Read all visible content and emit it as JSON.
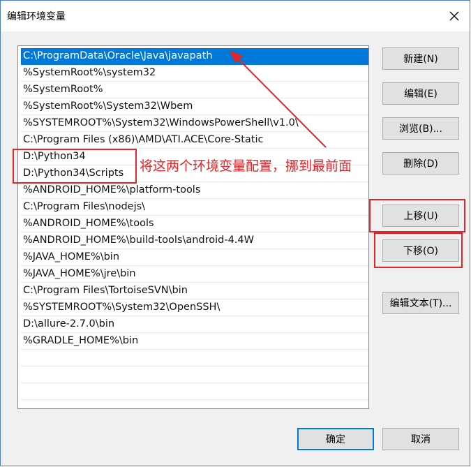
{
  "window": {
    "title": "编辑环境变量"
  },
  "list": {
    "selected_index": 0,
    "items": [
      "C:\\ProgramData\\Oracle\\Java\\javapath",
      "%SystemRoot%\\system32",
      "%SystemRoot%",
      "%SystemRoot%\\System32\\Wbem",
      "%SYSTEMROOT%\\System32\\WindowsPowerShell\\v1.0\\",
      "C:\\Program Files (x86)\\AMD\\ATI.ACE\\Core-Static",
      "D:\\Python34",
      "D:\\Python34\\Scripts",
      "%ANDROID_HOME%\\platform-tools",
      "C:\\Program Files\\nodejs\\",
      "%ANDROID_HOME%\\tools",
      "%ANDROID_HOME%\\build-tools\\android-4.4W",
      "%JAVA_HOME%\\bin",
      "%JAVA_HOME%\\jre\\bin",
      "C:\\Program Files\\TortoiseSVN\\bin",
      "%SYSTEMROOT%\\System32\\OpenSSH\\",
      "D:\\allure-2.7.0\\bin",
      "%GRADLE_HOME%\\bin"
    ]
  },
  "buttons": {
    "new": "新建(N)",
    "edit": "编辑(E)",
    "browse": "浏览(B)...",
    "delete": "删除(D)",
    "move_up": "上移(U)",
    "move_down": "下移(O)",
    "edit_text": "编辑文本(T)...",
    "ok": "确定",
    "cancel": "取消"
  },
  "annotation": {
    "text": "将这两个环境变量配置，挪到最前面",
    "color": "#e0262a"
  },
  "colors": {
    "selection": "#0078d7",
    "annotation_red": "#e0262a",
    "primary_border": "#0078d7"
  },
  "icons": {
    "close": "close-icon"
  }
}
